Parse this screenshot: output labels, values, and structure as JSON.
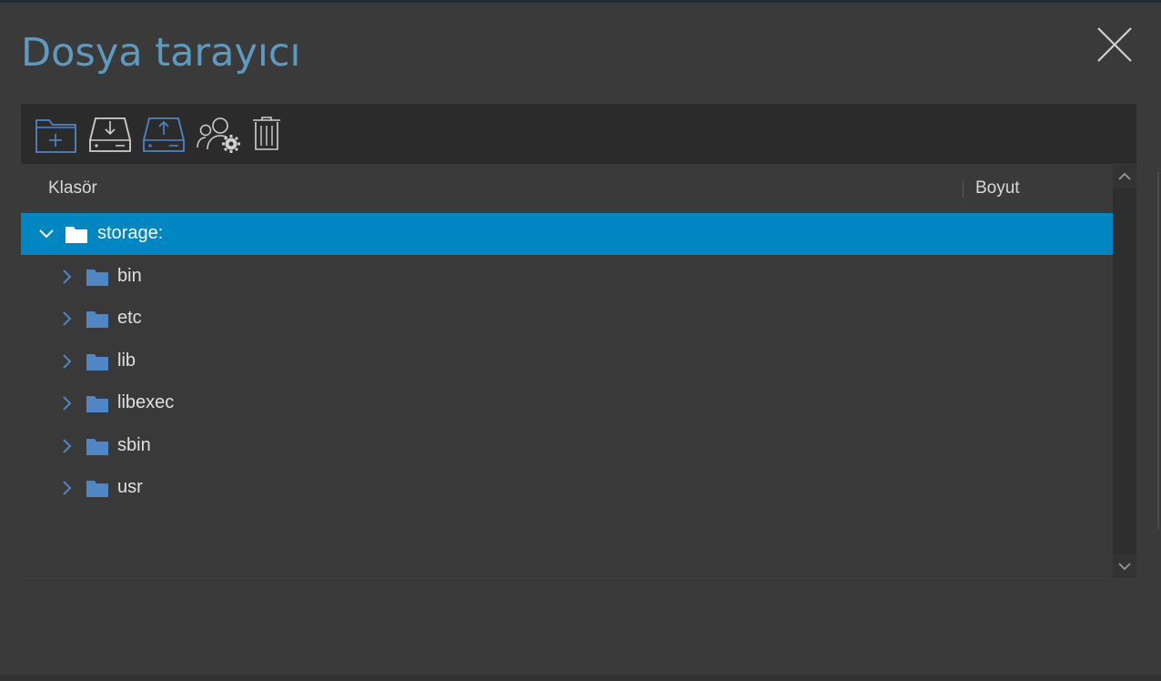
{
  "dialog": {
    "title": "Dosya tarayıcı"
  },
  "toolbar": {
    "buttons": [
      {
        "name": "new-folder",
        "icon": "folder-plus-icon"
      },
      {
        "name": "download",
        "icon": "drive-download-icon"
      },
      {
        "name": "upload",
        "icon": "drive-upload-icon"
      },
      {
        "name": "permissions",
        "icon": "users-gear-icon"
      },
      {
        "name": "delete",
        "icon": "trash-icon"
      }
    ]
  },
  "table": {
    "columns": {
      "folder": "Klasör",
      "size": "Boyut"
    },
    "root": {
      "label": "storage:",
      "expanded": true,
      "selected": true
    },
    "children": [
      {
        "label": "bin"
      },
      {
        "label": "etc"
      },
      {
        "label": "lib"
      },
      {
        "label": "libexec"
      },
      {
        "label": "sbin"
      },
      {
        "label": "usr"
      }
    ]
  },
  "colors": {
    "accent": "#5b9bc2",
    "selection": "#0086c0",
    "folder": "#4f86c6",
    "background": "#3a3a3a",
    "toolbar": "#2b2b2b"
  }
}
